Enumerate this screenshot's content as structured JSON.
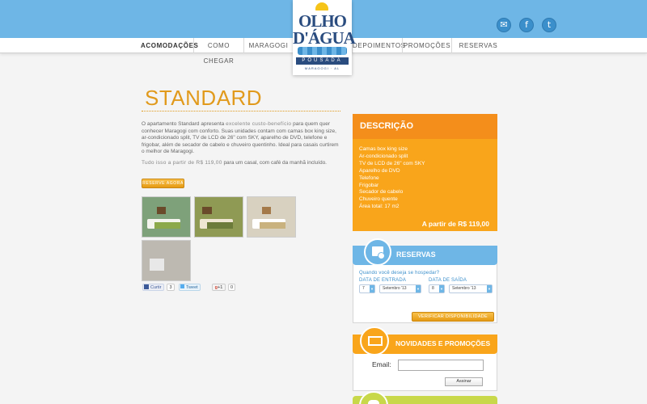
{
  "nav": {
    "items": [
      "ACOMODAÇÕES",
      "COMO CHEGAR",
      "MARAGOGI",
      "DEPOIMENTOS",
      "PROMOÇÕES",
      "RESERVAS"
    ]
  },
  "logo": {
    "line1": "OLHO",
    "line2": "D'ÁGUA",
    "pousada": "POUSADA",
    "place": "MARAGOGI · AL"
  },
  "social": [
    "tripadvisor-icon",
    "facebook-icon",
    "twitter-icon"
  ],
  "page": {
    "title": "STANDARD",
    "desc_pre": "O apartamento Standard apresenta ",
    "desc_hl": "excelente custo-benefício",
    "desc_post": " para quem quer conhecer Maragogi com conforto. Suas unidades contam com camas box king size, ar-condicionado split, TV de LCD de 26\" com SKY, aparelho de DVD, telefone e frigobar, além de secador de cabelo e chuveiro quentinho. Ideal para casais curtirem o melhor de Maragogi.",
    "price_hl": "Tudo isso a partir de R$ 119,00",
    "price_post": " para um casal, com café da manhã incluído.",
    "reserve_button": "RESERVE AGORA"
  },
  "share": {
    "facebook": "Curtir",
    "facebook_count": "3",
    "tweet": "Tweet",
    "gplus": "+1",
    "gplus_count": "0"
  },
  "description_box": {
    "title": "DESCRIÇÃO",
    "features": [
      "Camas box king size",
      "Ar-condicionado split",
      "TV de LCD de 26\" com SKY",
      "Aparelho de DVD",
      "Telefone",
      "Frigobar",
      "Secador de cabelo",
      "Chuveiro quente",
      "Área total: 17 m2"
    ],
    "price": "A partir de R$ 119,00"
  },
  "reservas": {
    "title": "RESERVAS",
    "question": "Quando você deseja se hospedar?",
    "checkin_label": "DATA DE ENTRADA",
    "checkout_label": "DATA DE SAÍDA",
    "checkin_day": "7",
    "checkin_month": "Setembro '13",
    "checkout_day": "8",
    "checkout_month": "Setembro '13",
    "verify_button": "VERIFICAR DISPONIBILIDADE"
  },
  "news": {
    "title": "NOVIDADES E PROMOÇÕES",
    "email_label": "Email:",
    "email_value": "",
    "submit": "Assinar"
  },
  "colors": {
    "sky": "#6eb6e6",
    "orange": "#f9a51b",
    "title_orange": "#e19a1c",
    "navy": "#2a4c7f"
  }
}
